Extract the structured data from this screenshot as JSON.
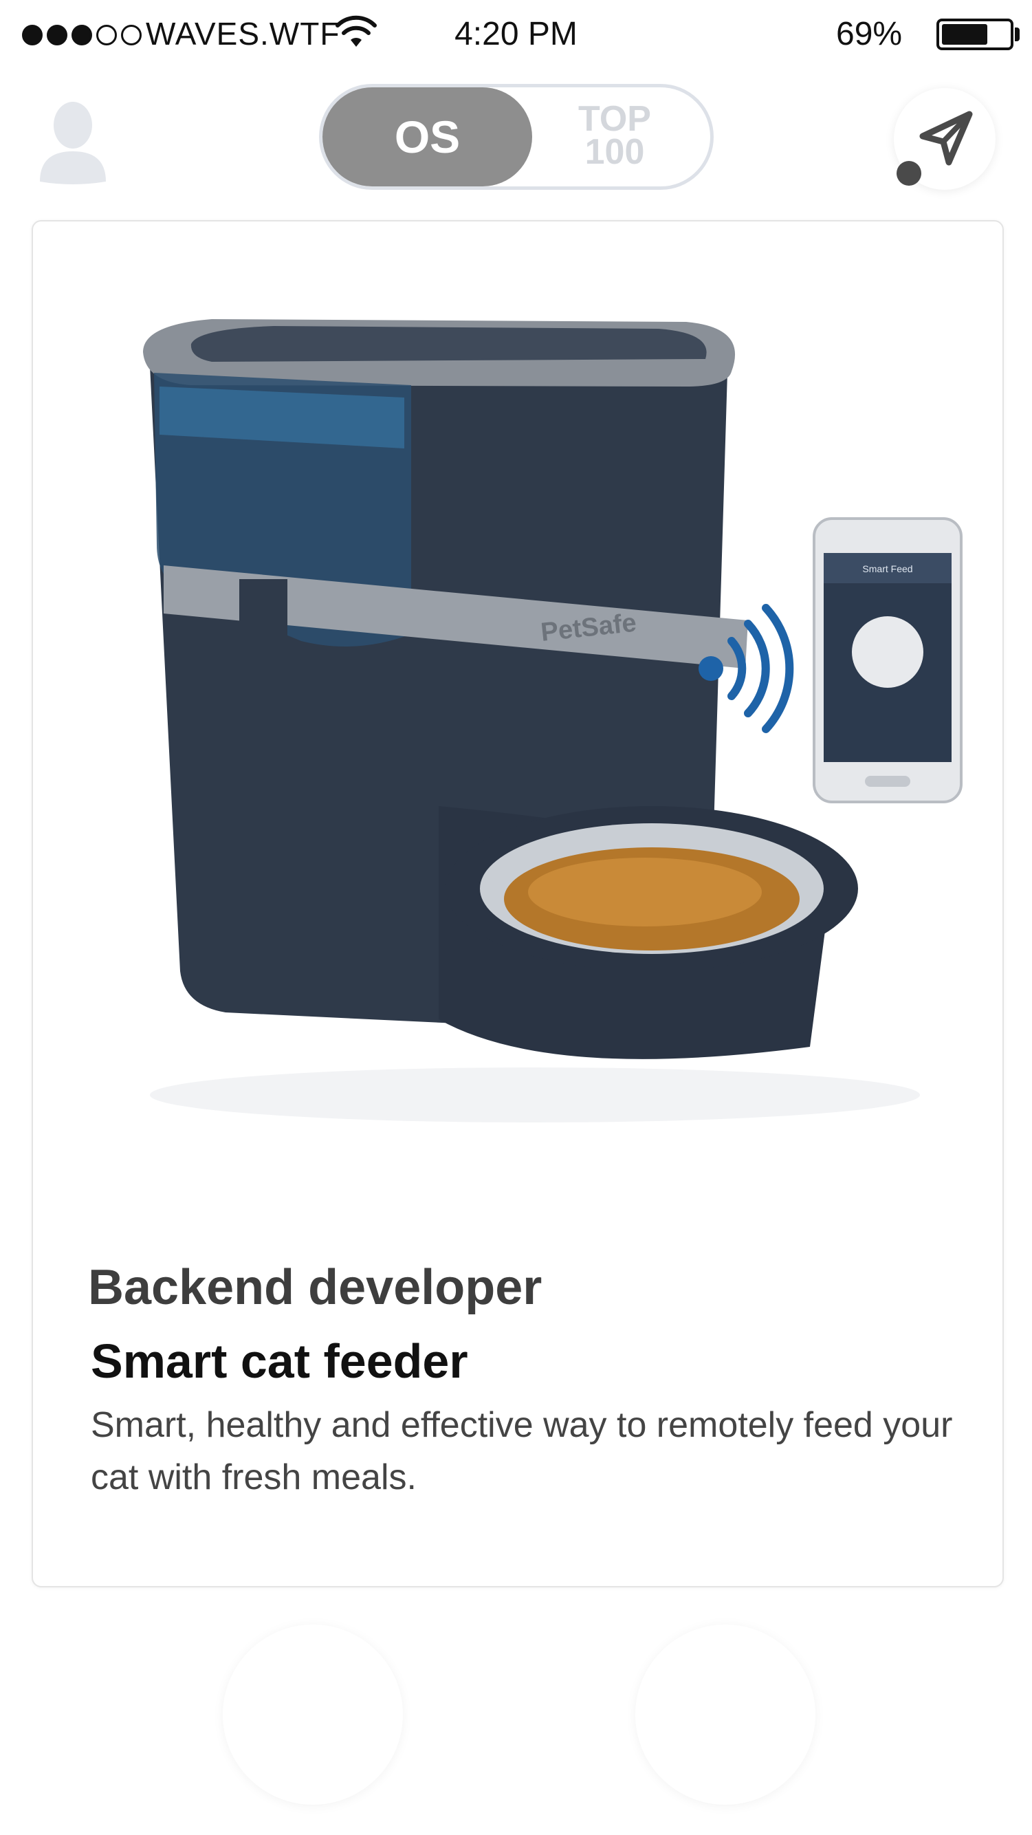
{
  "status_bar": {
    "carrier": "WAVES.WTF",
    "time": "4:20 PM",
    "battery_percent": "69%",
    "battery_level": 0.69,
    "signal_bars_filled": 3,
    "signal_bars_total": 5
  },
  "nav": {
    "tabs": [
      {
        "label": "OS",
        "active": true
      },
      {
        "label_line1": "TOP",
        "label_line2": "100",
        "active": false
      }
    ],
    "profile_icon": "user-silhouette-icon",
    "send_icon": "paper-plane-icon"
  },
  "card": {
    "image_alt": "Smart cat feeder product image",
    "brand_on_image": "PetSafe",
    "phone_header_on_image": "Smart Feed",
    "title": "Backend developer",
    "subtitle": "Smart cat feeder",
    "description": "Smart, healthy and effective way to remotely feed your cat with fresh meals."
  },
  "colors": {
    "toggle_active": "#8e8e8e",
    "toggle_border": "#dde1e8",
    "feeder_body": "#2f3a4a",
    "wifi_signal": "#1e63a8"
  }
}
